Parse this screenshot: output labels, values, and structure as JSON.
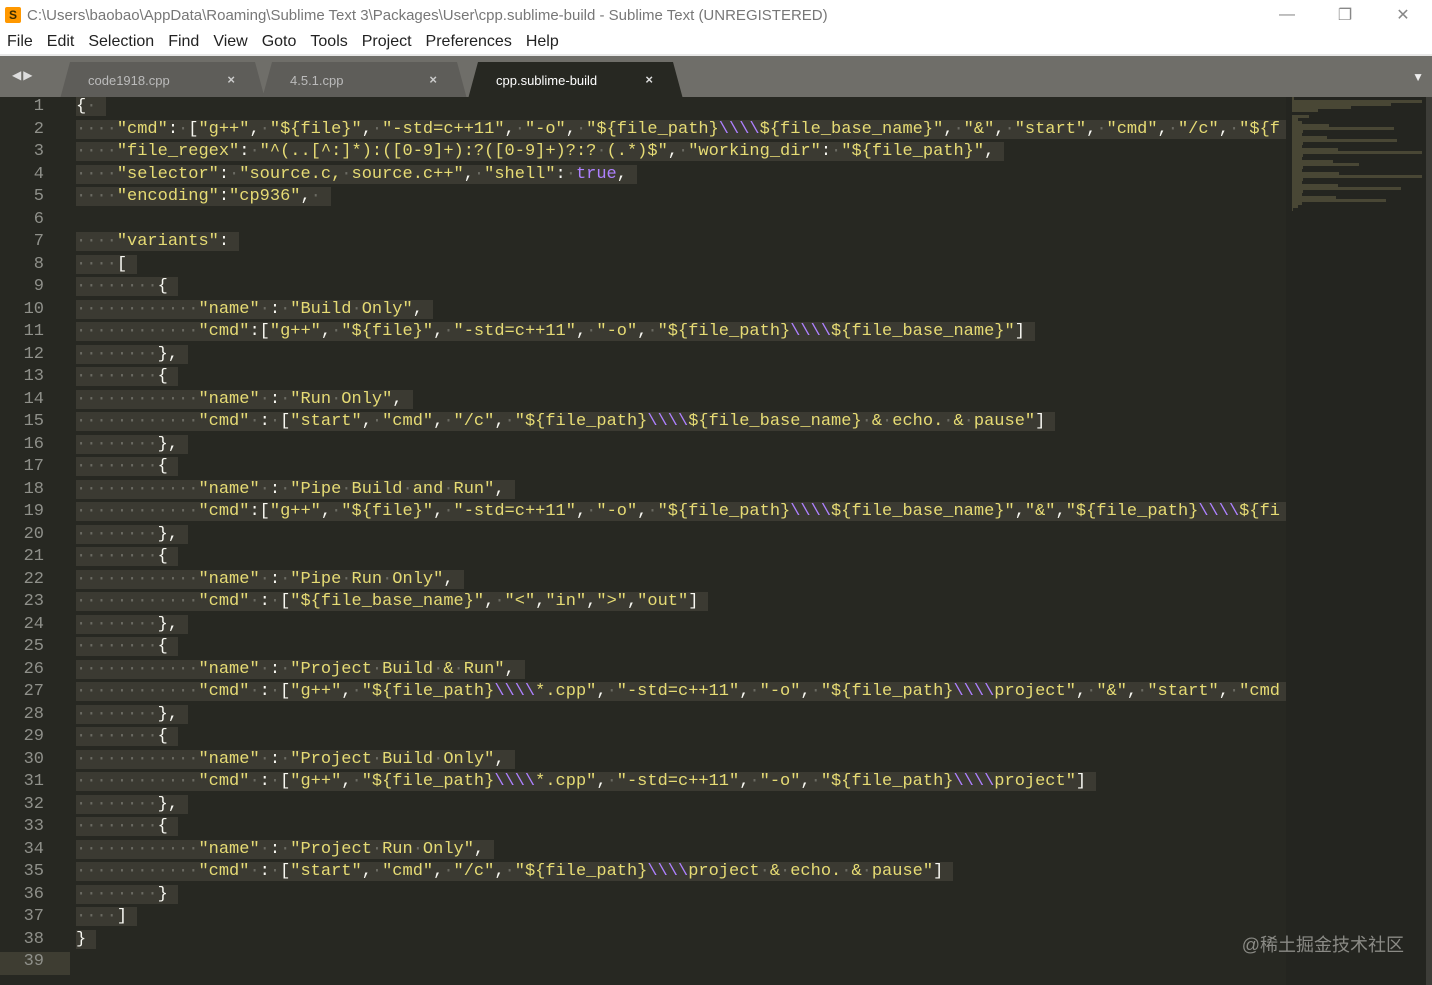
{
  "window": {
    "title": "C:\\Users\\baobao\\AppData\\Roaming\\Sublime Text 3\\Packages\\User\\cpp.sublime-build - Sublime Text (UNREGISTERED)",
    "minimize": "—",
    "restore": "❐",
    "close": "✕"
  },
  "menu": [
    "File",
    "Edit",
    "Selection",
    "Find",
    "View",
    "Goto",
    "Tools",
    "Project",
    "Preferences",
    "Help"
  ],
  "tabs": [
    {
      "label": "code1918.cpp",
      "active": false
    },
    {
      "label": "4.5.1.cpp",
      "active": false
    },
    {
      "label": "cpp.sublime-build",
      "active": true
    }
  ],
  "tab_close": "×",
  "nav_arrows": "◀▶",
  "dropdown": "▼",
  "current_line": 39,
  "lines": [
    "{ ",
    "    \"cmd\": [\"g++\", \"${file}\", \"-std=c++11\", \"-o\", \"${file_path}\\\\\\\\${file_base_name}\", \"&\", \"start\", \"cmd\", \"/c\", \"${f",
    "    \"file_regex\": \"^(..[^:]*):([0-9]+):?([0-9]+)?:? (.*)$\", \"working_dir\": \"${file_path}\",",
    "    \"selector\": \"source.c, source.c++\", \"shell\": true,",
    "    \"encoding\":\"cp936\", ",
    "",
    "    \"variants\":",
    "    [",
    "        {",
    "            \"name\" : \"Build Only\",",
    "            \"cmd\":[\"g++\", \"${file}\", \"-std=c++11\", \"-o\", \"${file_path}\\\\\\\\${file_base_name}\"]",
    "        },",
    "        {",
    "            \"name\" : \"Run Only\",",
    "            \"cmd\" : [\"start\", \"cmd\", \"/c\", \"${file_path}\\\\\\\\${file_base_name} & echo. & pause\"]",
    "        },",
    "        {",
    "            \"name\" : \"Pipe Build and Run\",",
    "            \"cmd\":[\"g++\", \"${file}\", \"-std=c++11\", \"-o\", \"${file_path}\\\\\\\\${file_base_name}\",\"&\",\"${file_path}\\\\\\\\${fi",
    "        },",
    "        {",
    "            \"name\" : \"Pipe Run Only\",",
    "            \"cmd\" : [\"${file_base_name}\", \"<\",\"in\",\">\",\"out\"]",
    "        },",
    "        {",
    "            \"name\" : \"Project Build & Run\",",
    "            \"cmd\" : [\"g++\", \"${file_path}\\\\\\\\*.cpp\", \"-std=c++11\", \"-o\", \"${file_path}\\\\\\\\project\", \"&\", \"start\", \"cmd",
    "        },",
    "        {",
    "            \"name\" : \"Project Build Only\",",
    "            \"cmd\" : [\"g++\", \"${file_path}\\\\\\\\*.cpp\", \"-std=c++11\", \"-o\", \"${file_path}\\\\\\\\project\"]",
    "        },",
    "        {",
    "            \"name\" : \"Project Run Only\",",
    "            \"cmd\" : [\"start\", \"cmd\", \"/c\", \"${file_path}\\\\\\\\project & echo. & pause\"]",
    "        }",
    "    ]",
    "}",
    ""
  ],
  "watermark": "@稀土掘金技术社区"
}
